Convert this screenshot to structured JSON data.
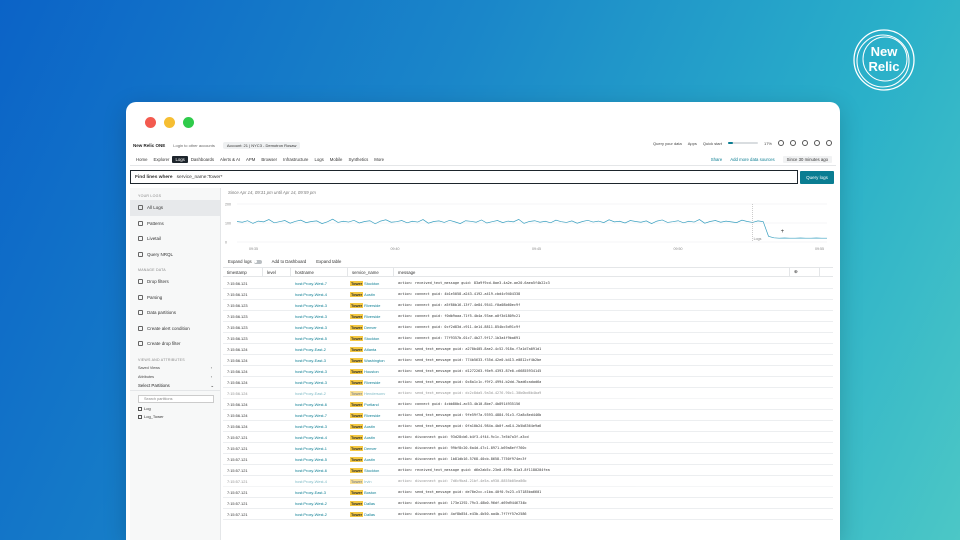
{
  "brand_logo": {
    "line1": "New",
    "line2": "Relic"
  },
  "topbar": {
    "app_name": "New Relic ONE",
    "login_text": "Login to other accounts",
    "account": "Account: 21 | NYC3 - Demotron Rosaw",
    "query_your_data": "Query your data",
    "apps": "Apps",
    "quick_start": "Quick start",
    "quick_start_pct": "17%",
    "quick_start_fraction": 0.17
  },
  "nav": {
    "items": [
      "Home",
      "Explorer",
      "Logs",
      "Dashboards",
      "Alerts & AI",
      "APM",
      "Browser",
      "Infrastructure",
      "Logs",
      "Mobile",
      "Synthetics",
      "More"
    ],
    "active_index": 2,
    "share": "Share",
    "add_data": "Add more data sources",
    "time_range": "Since 30 minutes ago"
  },
  "query": {
    "label": "Find lines where",
    "value": "service_name:Tower*",
    "button": "Query logs"
  },
  "sidebar": {
    "section1": "YOUR LOGS",
    "items1": [
      "All Logs",
      "Patterns",
      "Livetail",
      "Query NRQL"
    ],
    "section2": "MANAGE DATA",
    "items2": [
      "Drop filters",
      "Parsing",
      "Data partitions",
      "Create alert condition",
      "Create drop filter"
    ],
    "section3": "VIEWS AND ATTRIBUTES",
    "saved_views": "Saved Views",
    "attributes": "Attributes",
    "select_partitions": "Select Partitions",
    "search_placeholder": "Search partitions",
    "partitions": [
      "Log",
      "Log_Tower"
    ]
  },
  "main": {
    "since_text": "Since Apr 14, 09:31 pm until Apr 14, 09:59 pm",
    "expand_logs": "Expand logs",
    "add_dashboard": "Add to Dashboard",
    "expand_table": "Expand table"
  },
  "chart_data": {
    "type": "line",
    "y_ticks": [
      "200",
      "100",
      "0"
    ],
    "x_ticks": [
      "09:35",
      "09:40",
      "09:45",
      "09:50",
      "09:55"
    ],
    "ylim": [
      0,
      200
    ],
    "values": [
      108,
      104,
      112,
      98,
      110,
      106,
      118,
      101,
      107,
      113,
      99,
      109,
      115,
      102,
      108,
      111,
      97,
      106,
      120,
      103,
      109,
      105,
      114,
      100,
      108,
      112,
      96,
      110,
      117,
      104,
      107,
      113,
      101,
      109,
      105,
      118,
      99,
      108,
      111,
      103,
      114,
      106,
      97,
      112,
      109,
      104,
      116,
      100,
      107,
      113,
      102,
      110,
      106,
      119,
      98,
      108,
      112,
      104,
      109,
      101,
      115,
      107,
      103,
      111,
      99,
      108,
      114,
      105,
      110,
      102,
      117,
      106,
      109,
      100,
      113,
      108,
      104,
      111,
      97,
      110,
      116,
      103,
      107,
      112,
      101,
      109,
      105,
      118,
      99,
      108,
      113,
      104,
      110,
      106,
      102,
      115,
      108,
      103,
      111,
      107,
      30,
      22,
      20,
      21,
      20,
      20,
      21,
      20,
      20,
      21,
      20,
      20
    ],
    "annotation": "Logs",
    "grid": true
  },
  "table": {
    "columns": [
      "timestamp",
      "level",
      "hostname",
      "service_name",
      "message"
    ],
    "service_tag": "Tower",
    "rows": [
      {
        "ts": "7:15:56.121",
        "host": "host:Proxy-West-7",
        "svc": "Stockton",
        "msg": "action: received_text_message guid: 83a9f9cd-0ae3-4a2e-ae20-6aea5f4b22c3"
      },
      {
        "ts": "7:15:56.121",
        "host": "host:Proxy-West-4",
        "svc": "Austin",
        "msg": "action: connect guid: 4b1e5058-a243-4192-a419-cbd4c9404338"
      },
      {
        "ts": "7:15:56.123",
        "host": "host:Proxy-West-3",
        "svc": "Riverside",
        "msg": "action: connect guid: a5f80b16-13f7-4e84-9541-f0a08b60ec9f"
      },
      {
        "ts": "7:15:56.123",
        "host": "host:Proxy-West-3",
        "svc": "Riverside",
        "msg": "action: connect guid: f0db9aaa-71f5-4b4a-93ae-a0f3d1809c21"
      },
      {
        "ts": "7:15:56.123",
        "host": "host:Proxy-West-3",
        "svc": "Denver",
        "msg": "action: connect guid: 0cf2d83d-c911-4e14-8811-854bc5d91c9f"
      },
      {
        "ts": "7:15:56.123",
        "host": "host:Proxy-West-5",
        "svc": "Stockton",
        "msg": "action: connect guid: 77f9357b-01c7-4b27-9f17-1b3a4f9ba691"
      },
      {
        "ts": "7:15:56.124",
        "host": "host:Proxy-East-2",
        "svc": "Atlanta",
        "msg": "action: send_text_message guid: a270b405-8ae2-4c52-918a-f7a1d7a091d1"
      },
      {
        "ts": "7:15:56.124",
        "host": "host:Proxy-East-3",
        "svc": "Washington",
        "msg": "action: send_text_message guid: 774b5633-f35d-42e0-b413-e0812cf4b2be"
      },
      {
        "ts": "7:15:56.124",
        "host": "host:Proxy-West-3",
        "svc": "Houston",
        "msg": "action: send_text_message guid: d1272263-f6e9-4393-87e0-c66855934145"
      },
      {
        "ts": "7:15:56.124",
        "host": "host:Proxy-West-3",
        "svc": "Riverside",
        "msg": "action: send_text_message guid: 0c8a1c1c-f9f2-4994-b2dd-7bad6cadad6a"
      },
      {
        "ts": "7:15:56.124",
        "host": "host:Proxy-East-2",
        "svc": "Hendersonv",
        "msg": "action: send_text_message guid: dc2c8da5-9a3d-4276-90c1-30b0bd6b4ba9"
      },
      {
        "ts": "7:15:56.124",
        "host": "host:Proxy-West-6",
        "svc": "Portland",
        "msg": "action: connect guid: 4cbb80b4-ac53-4b10-8be7-4b8914935156"
      },
      {
        "ts": "7:15:56.124",
        "host": "host:Proxy-West-7",
        "svc": "Riverside",
        "msg": "action: send_text_message guid: 9fe59f7a-9393-4884-91c3-f2a8c8ed446b"
      },
      {
        "ts": "7:15:56.124",
        "host": "host:Proxy-West-3",
        "svc": "Austin",
        "msg": "action: send_text_message guid: 0fa10b24-984a-4b0f-ad14-2b5b8364e9a6"
      },
      {
        "ts": "7:15:57.121",
        "host": "host:Proxy-West-4",
        "svc": "Austin",
        "msg": "action: disconnect guid: 93d28cb6-b4f3-4f44-9c1c-7e5b7a3f-a3cd"
      },
      {
        "ts": "7:15:57.121",
        "host": "host:Proxy-West-1",
        "svc": "Denver",
        "msg": "action: disconnect guid: 99bf8c20-6a4d-47c1-8971-b69a8eff760c"
      },
      {
        "ts": "7:15:57.121",
        "host": "host:Proxy-West-5",
        "svc": "Austin",
        "msg": "action: disconnect guid: 1b81db16-5768-40cb-8658-7750f974ec3f"
      },
      {
        "ts": "7:15:57.121",
        "host": "host:Proxy-West-6",
        "svc": "Stockton",
        "msg": "action: received_text_message guid: d6e2ab5c-23e0-499e-81a3-8f1180204fea"
      },
      {
        "ts": "7:15:57.121",
        "host": "host:Proxy-West-4",
        "svc": "Irvin",
        "msg": "action: disconnect guid: 7d6c9ba4-21bf-4e5a-a930-8855b05ea86b"
      },
      {
        "ts": "7:15:57.121",
        "host": "host:Proxy-East-3",
        "svc": "Boston",
        "msg": "action: send_text_message guid: de70e2cc-c1ba-40f0-9c23-c57185ba6601"
      },
      {
        "ts": "7:15:57.121",
        "host": "host:Proxy-West-2",
        "svc": "Dallas",
        "msg": "action: disconnect guid: 173e1292-79c3-48b0-96df-d69d9446734b"
      },
      {
        "ts": "7:15:57.121",
        "host": "host:Proxy-West-2",
        "svc": "Dallas",
        "msg": "action: disconnect guid: 4af8b854-e43b-4b50-aa4b-7f7ff57e2586"
      }
    ]
  },
  "colors": {
    "accent": "#0a7d92",
    "tag": "#f5c842",
    "chart_line": "#3aa0c0"
  }
}
